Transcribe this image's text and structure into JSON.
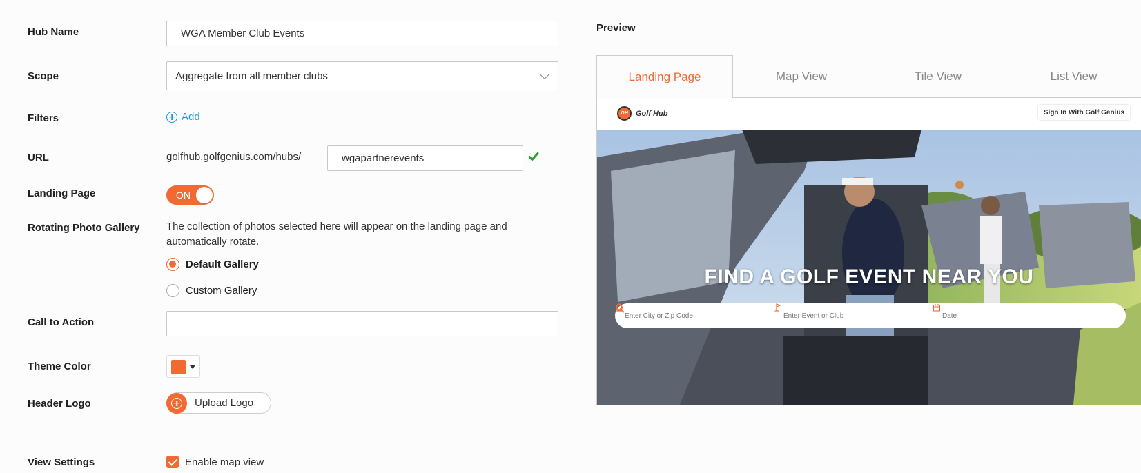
{
  "form": {
    "hub_name": {
      "label": "Hub Name",
      "value": "WGA Member Club Events"
    },
    "scope": {
      "label": "Scope",
      "value": "Aggregate from all member clubs"
    },
    "filters": {
      "label": "Filters",
      "add_label": "Add"
    },
    "url": {
      "label": "URL",
      "prefix": "golfhub.golfgenius.com/hubs/",
      "value": "wgapartnerevents"
    },
    "landing_page": {
      "label": "Landing Page",
      "toggle_label": "ON"
    },
    "gallery": {
      "label": "Rotating Photo Gallery",
      "description": "The collection of photos selected here will appear on the landing page and automatically rotate.",
      "options": [
        "Default Gallery",
        "Custom Gallery"
      ],
      "selected": "Default Gallery"
    },
    "call_to_action": {
      "label": "Call to Action",
      "value": ""
    },
    "theme_color": {
      "label": "Theme Color",
      "color": "#f26a33"
    },
    "header_logo": {
      "label": "Header Logo",
      "button_label": "Upload Logo"
    },
    "view_settings": {
      "label": "View Settings",
      "checkbox_label": "Enable map view",
      "checked": true
    }
  },
  "preview": {
    "title": "Preview",
    "tabs": [
      "Landing Page",
      "Map View",
      "Tile View",
      "List View"
    ],
    "active_tab": "Landing Page",
    "header": {
      "logo_mark": "GH",
      "logo_text": "Golf Hub",
      "signin": "Sign In With Golf Genius"
    },
    "hero_title": "FIND A GOLF EVENT NEAR YOU",
    "search": {
      "location_placeholder": "Enter City or Zip Code",
      "event_placeholder": "Enter Event or Club",
      "date_placeholder": "Date"
    }
  },
  "colors": {
    "accent": "#f26a33",
    "link": "#1b9bd7",
    "check": "#2a9d2a"
  }
}
